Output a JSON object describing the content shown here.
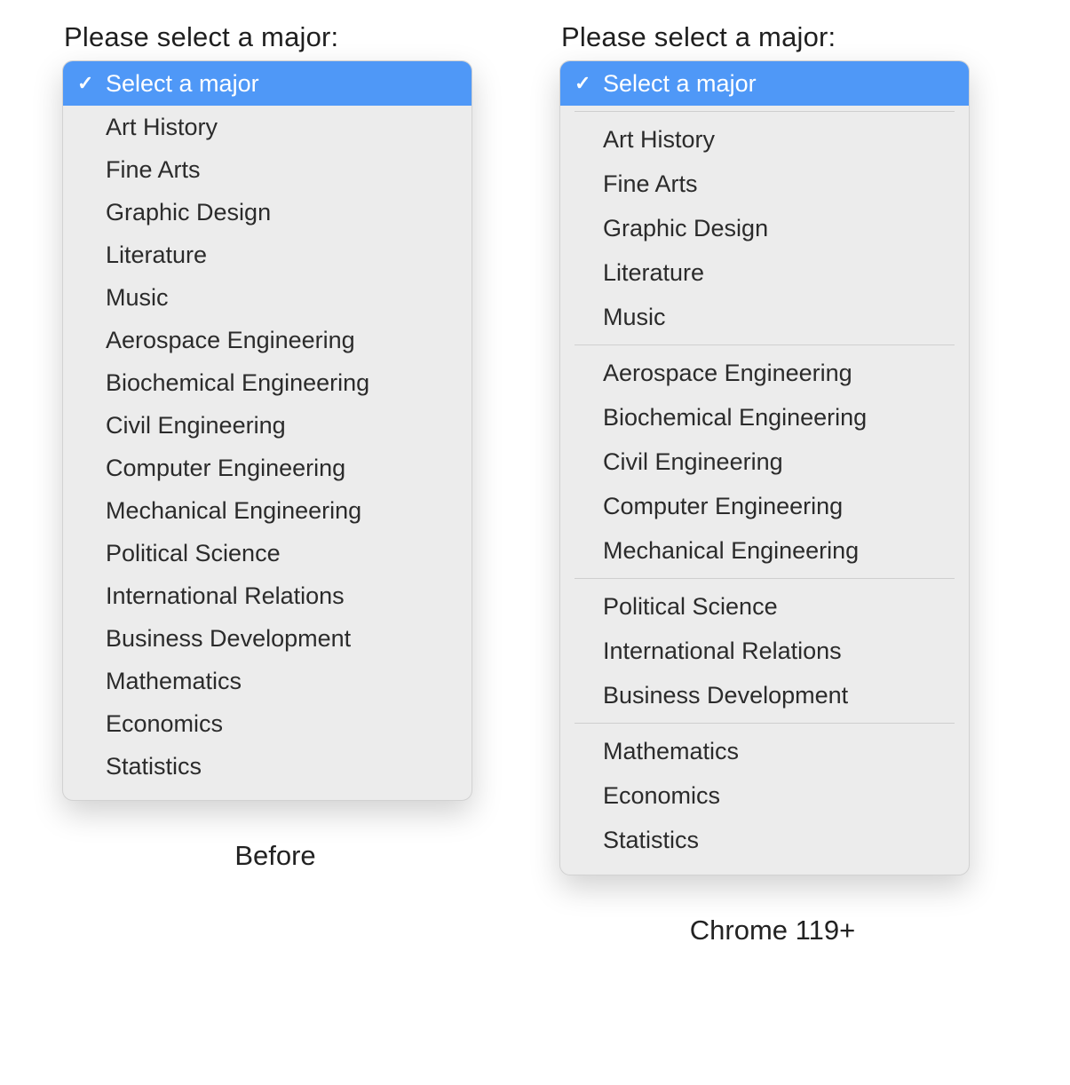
{
  "left": {
    "label": "Please select a major:",
    "caption": "Before",
    "selected_label": "Select a major",
    "options": [
      "Art History",
      "Fine Arts",
      "Graphic Design",
      "Literature",
      "Music",
      "Aerospace Engineering",
      "Biochemical Engineering",
      "Civil Engineering",
      "Computer Engineering",
      "Mechanical Engineering",
      "Political Science",
      "International Relations",
      "Business Development",
      "Mathematics",
      "Economics",
      "Statistics"
    ]
  },
  "right": {
    "label": "Please select a major:",
    "caption": "Chrome 119+",
    "selected_label": "Select a major",
    "groups": [
      {
        "items": [
          "Art History",
          "Fine Arts",
          "Graphic Design",
          "Literature",
          "Music"
        ]
      },
      {
        "items": [
          "Aerospace Engineering",
          "Biochemical Engineering",
          "Civil Engineering",
          "Computer Engineering",
          "Mechanical Engineering"
        ]
      },
      {
        "items": [
          "Political Science",
          "International Relations",
          "Business Development"
        ]
      },
      {
        "items": [
          "Mathematics",
          "Economics",
          "Statistics"
        ]
      }
    ]
  }
}
